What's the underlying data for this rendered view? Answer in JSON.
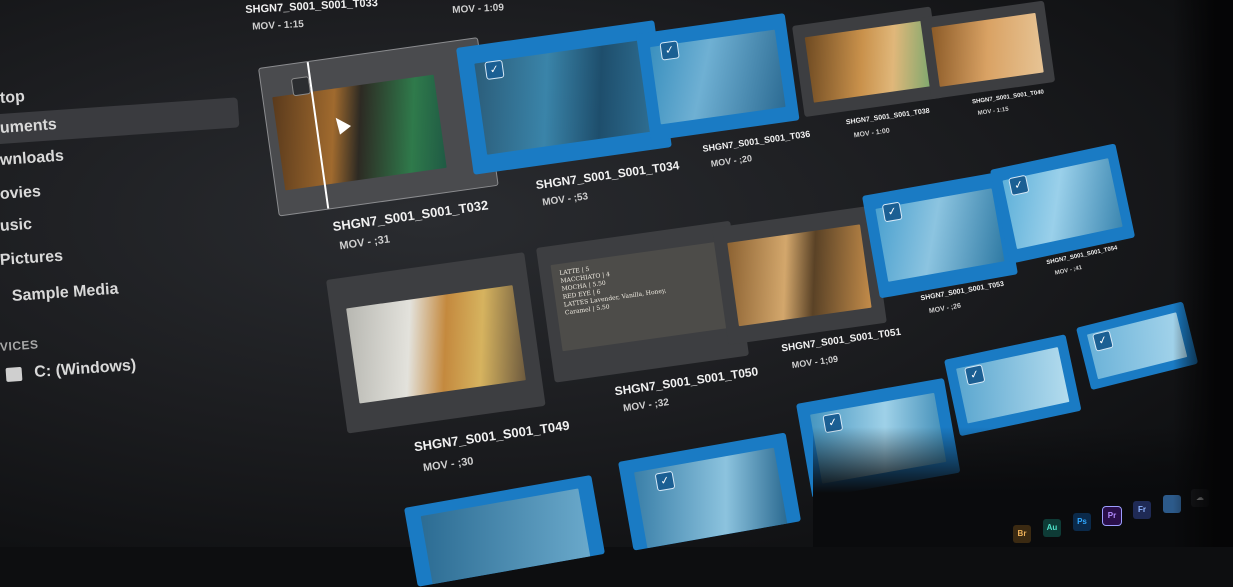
{
  "sidebar": {
    "items": [
      {
        "label": "top"
      },
      {
        "label": "uments"
      },
      {
        "label": "wnloads"
      },
      {
        "label": "ovies"
      },
      {
        "label": "usic"
      },
      {
        "label": "Pictures"
      },
      {
        "label": "Sample Media"
      }
    ],
    "devices_header": "VICES",
    "drive_label": "C: (Windows)"
  },
  "tiles": [
    {
      "name": "SHGN7_S001_S001_T033",
      "meta": "MOV - 1:15",
      "selected": false
    },
    {
      "name": "",
      "meta": "MOV - 1:09",
      "selected": false
    },
    {
      "name": "SHGN7_S001_S001_T032",
      "meta": "MOV - ;31",
      "selected": false
    },
    {
      "name": "SHGN7_S001_S001_T034",
      "meta": "MOV - ;53",
      "selected": true
    },
    {
      "name": "SHGN7_S001_S001_T036",
      "meta": "MOV - ;20",
      "selected": true
    },
    {
      "name": "SHGN7_S001_S001_T038",
      "meta": "MOV - 1:00",
      "selected": false
    },
    {
      "name": "SHGN7_S001_S001_T040",
      "meta": "MOV - 1:15",
      "selected": false
    },
    {
      "name": "SHGN7_S001_S001_T049",
      "meta": "MOV - ;30",
      "selected": false
    },
    {
      "name": "SHGN7_S001_S001_T050",
      "meta": "MOV - ;32",
      "selected": false
    },
    {
      "name": "SHGN7_S001_S001_T051",
      "meta": "MOV - 1;09",
      "selected": false
    },
    {
      "name": "SHGN7_S001_S001_T053",
      "meta": "MOV - ;26",
      "selected": true
    },
    {
      "name": "SHGN7_S001_S001_T054",
      "meta": "MOV - ;41",
      "selected": true
    }
  ],
  "menu_board": {
    "lines": [
      "LATTE | 5",
      "MACCHIATO | 4",
      "MOCHA | 5.50",
      "RED EYE | 6",
      "LATTES Lavender, Vanilla, Honey,",
      "Caramel | 5.50"
    ]
  },
  "taskbar": {
    "apps": [
      "Br",
      "Au",
      "Ps",
      "Pr",
      "Fr"
    ]
  },
  "colors": {
    "selection_blue": "#1a7bc4",
    "tile_gray": "#3d3e41",
    "background": "#1c1d20"
  }
}
